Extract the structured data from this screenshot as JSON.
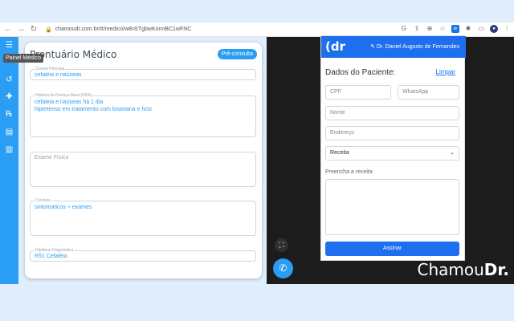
{
  "browser": {
    "url": "chamoudr.com.br/#/medico/w8n5TgbwKonnBC1wFNC"
  },
  "sidebar": {
    "tooltip": "Painel Médico"
  },
  "record": {
    "title": "Prontuário Médico",
    "pre_consulta": "Pré-consulta",
    "fields": [
      {
        "label": "Queixa Principal",
        "value": "cefaleia e naúseas"
      },
      {
        "label": "História da Doença Atual (HDA)",
        "value": "cefaleia e naúseas há 1 dia\nhipertenso em tratamento com losartana e hctz"
      },
      {
        "label": "",
        "placeholder": "Exame Físico",
        "value": ""
      },
      {
        "label": "Conduta",
        "value": "sintomaticos + exames"
      },
      {
        "label": "Hipótese Diagnóstica",
        "value": "R51 Cefaleia"
      }
    ]
  },
  "panel": {
    "logo": "(dr",
    "doctor": "✎ Dr. Daniel Augusto de Fernandes",
    "title": "Dados do Paciente:",
    "clear": "Limpar",
    "cpf_placeholder": "CPF",
    "whatsapp_placeholder": "WhatsApp",
    "name_placeholder": "Nome",
    "address_placeholder": "Endereço",
    "select_value": "Receita",
    "fill_label": "Preencha a receita",
    "sign_button": "Assinar"
  },
  "brand": {
    "part1": "Chamou",
    "part2": "Dr."
  }
}
